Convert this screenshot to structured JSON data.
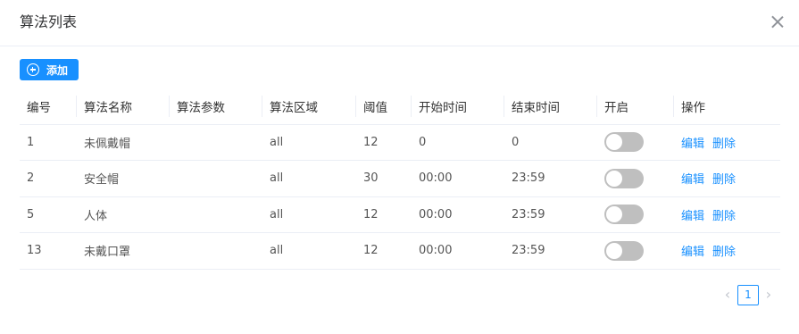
{
  "dialog": {
    "title": "算法列表"
  },
  "toolbar": {
    "add_label": "添加"
  },
  "table": {
    "headers": [
      "编号",
      "算法名称",
      "算法参数",
      "算法区域",
      "阈值",
      "开始时间",
      "结束时间",
      "开启",
      "操作"
    ],
    "rows": [
      {
        "id": "1",
        "name": "未佩戴帽",
        "params": "",
        "region": "all",
        "threshold": "12",
        "start": "0",
        "end": "0",
        "enabled": false
      },
      {
        "id": "2",
        "name": "安全帽",
        "params": "",
        "region": "all",
        "threshold": "30",
        "start": "00:00",
        "end": "23:59",
        "enabled": false
      },
      {
        "id": "5",
        "name": "人体",
        "params": "",
        "region": "all",
        "threshold": "12",
        "start": "00:00",
        "end": "23:59",
        "enabled": false
      },
      {
        "id": "13",
        "name": "未戴口罩",
        "params": "",
        "region": "all",
        "threshold": "12",
        "start": "00:00",
        "end": "23:59",
        "enabled": false
      }
    ],
    "actions": {
      "edit": "编辑",
      "delete": "删除"
    }
  },
  "pagination": {
    "current_page": "1",
    "prev_icon": "chevron-left-icon",
    "next_icon": "chevron-right-icon"
  },
  "colors": {
    "accent": "#1890ff",
    "switch_off": "#bfbfbf"
  }
}
